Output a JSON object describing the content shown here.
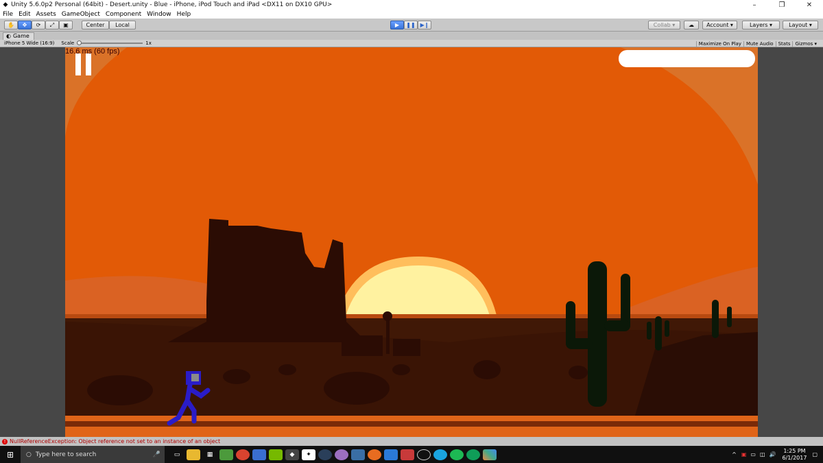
{
  "window": {
    "title": "Unity 5.6.0p2 Personal (64bit) - Desert.unity - Blue - iPhone, iPod Touch and iPad <DX11 on DX10 GPU>",
    "controls": {
      "minimize": "–",
      "maximize": "❐",
      "close": "✕"
    }
  },
  "menu": [
    "File",
    "Edit",
    "Assets",
    "GameObject",
    "Component",
    "Window",
    "Help"
  ],
  "toolbar": {
    "pivot_label": "Center",
    "space_label": "Local",
    "collab_label": "Collab ▾",
    "account_label": "Account",
    "layers_label": "Layers",
    "layout_label": "Layout"
  },
  "tab": {
    "label": "Game"
  },
  "gamebar": {
    "resolution": "iPhone 5 Wide (16:9)",
    "scale_label": "Scale",
    "scale_value": "1x",
    "maximize_on_play": "Maximize On Play",
    "mute_audio": "Mute Audio",
    "stats": "Stats",
    "gizmos": "Gizmos ▾"
  },
  "game": {
    "fps_text": "16.6 ms (60 fps)",
    "colors": {
      "sky": "#e35a06",
      "sky_band": "#dd7a2c",
      "sun_outer": "#ffbe5c",
      "sun": "#fff2a0",
      "ground": "#3d1605",
      "silhouette": "#2b0c04",
      "cactus": "#0b1808",
      "player": "#2a1cc8"
    }
  },
  "status": {
    "error": "NullReferenceException: Object reference not set to an instance of an object"
  },
  "taskbar": {
    "search_placeholder": "Type here to search",
    "time": "1:25 PM",
    "date": "6/1/2017"
  }
}
